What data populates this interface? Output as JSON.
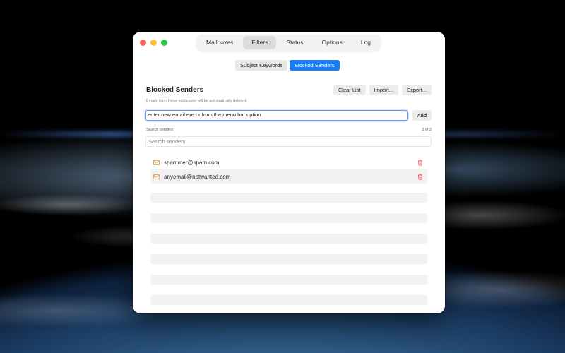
{
  "toolbar": {
    "tabs": [
      "Mailboxes",
      "Filters",
      "Status",
      "Options",
      "Log"
    ],
    "active_tab": "Filters"
  },
  "sub_tabs": {
    "items": [
      "Subject Keywords",
      "Blocked Senders"
    ],
    "active": "Blocked Senders"
  },
  "section": {
    "title": "Blocked Senders",
    "subtitle": "Emails from these addresses will be automatically deleted"
  },
  "actions": {
    "clear": "Clear List",
    "import": "Import...",
    "export": "Export..."
  },
  "add_email": {
    "value": "enter new email ere or from the menu bar option",
    "button": "Add"
  },
  "search": {
    "label": "Search senders",
    "placeholder": "Search senders",
    "count": "2 of 2"
  },
  "senders": [
    {
      "email": "spammer@spam.com"
    },
    {
      "email": "anyemail@notwanted.com"
    }
  ],
  "colors": {
    "accent": "#1a7cf5",
    "mail_icon": "#e0902a",
    "trash_icon": "#e5484d"
  }
}
